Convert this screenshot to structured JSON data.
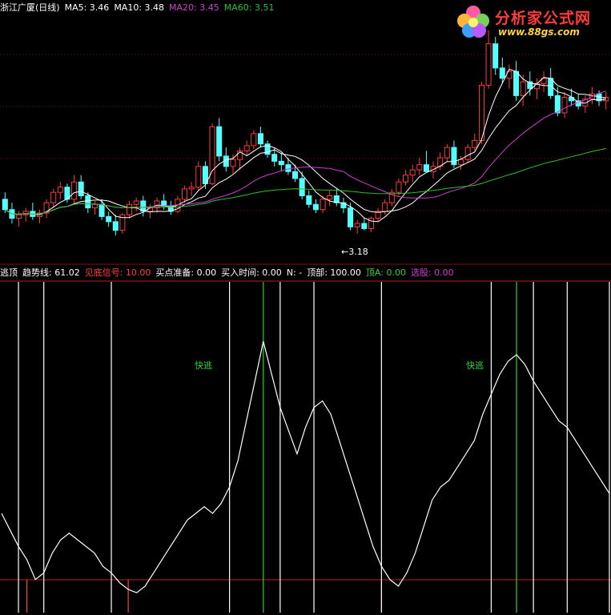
{
  "colors": {
    "background": "#000000",
    "up_candle": "#ff3b3b",
    "down_candle": "#54ffff",
    "ma5": "#ffffff",
    "ma10": "#ffffff",
    "ma20": "#d23bd2",
    "ma60": "#2fbf2f",
    "grid_dots": "#7a1010",
    "trend_line": "#ffffff",
    "bottom_signal": "#ff4040",
    "buy_signal": "#ffff80",
    "top_signal": "#ffffff",
    "fast_escape": "#33d033",
    "ref_line_top": "#ff3030",
    "ref_line_bottom": "#c02020"
  },
  "price_header": {
    "stock": "浙江广厦(日线)",
    "ma5": "MA5: 3.46",
    "ma10": "MA10: 3.48",
    "ma20": "MA20: 3.45",
    "ma60": "MA60: 3.51"
  },
  "indicator_header": {
    "name": "逃顶",
    "trend": "趋势线: 61.02",
    "bottom_signal": "见底信号: 10.00",
    "buy_prep": "买点准备: 0.00",
    "buy_time": "买入时间: 0.00",
    "n": "N: -",
    "top": "顶部: 100.00",
    "top_a": "顶A: 0.00",
    "select": "选股: 0.00"
  },
  "logo": {
    "title": "分析家公式网",
    "url": "www.88gs.com",
    "icon": "flower-logo-icon"
  },
  "annotations": {
    "low_price": "3.18",
    "fast_escape_1": "快逃",
    "fast_escape_2": "快逃"
  },
  "chart_data": [
    {
      "type": "candlestick",
      "title": "浙江广厦(日线)",
      "ylim": [
        3.05,
        4.45
      ],
      "annotations": [
        "3.18"
      ],
      "candles": [
        [
          3.38,
          3.42,
          3.3,
          3.32
        ],
        [
          3.32,
          3.36,
          3.24,
          3.27
        ],
        [
          3.27,
          3.31,
          3.22,
          3.29
        ],
        [
          3.29,
          3.33,
          3.25,
          3.31
        ],
        [
          3.31,
          3.36,
          3.26,
          3.28
        ],
        [
          3.28,
          3.32,
          3.24,
          3.3
        ],
        [
          3.3,
          3.38,
          3.27,
          3.36
        ],
        [
          3.36,
          3.44,
          3.33,
          3.42
        ],
        [
          3.42,
          3.48,
          3.38,
          3.45
        ],
        [
          3.45,
          3.47,
          3.36,
          3.38
        ],
        [
          3.38,
          3.52,
          3.35,
          3.48
        ],
        [
          3.48,
          3.52,
          3.38,
          3.4
        ],
        [
          3.4,
          3.42,
          3.3,
          3.33
        ],
        [
          3.33,
          3.37,
          3.29,
          3.35
        ],
        [
          3.35,
          3.38,
          3.26,
          3.28
        ],
        [
          3.28,
          3.31,
          3.22,
          3.25
        ],
        [
          3.25,
          3.29,
          3.17,
          3.2
        ],
        [
          3.2,
          3.3,
          3.18,
          3.29
        ],
        [
          3.29,
          3.37,
          3.27,
          3.35
        ],
        [
          3.35,
          3.39,
          3.31,
          3.37
        ],
        [
          3.37,
          3.4,
          3.28,
          3.31
        ],
        [
          3.31,
          3.35,
          3.27,
          3.33
        ],
        [
          3.33,
          3.39,
          3.3,
          3.37
        ],
        [
          3.37,
          3.41,
          3.32,
          3.34
        ],
        [
          3.34,
          3.37,
          3.29,
          3.31
        ],
        [
          3.31,
          3.4,
          3.3,
          3.38
        ],
        [
          3.38,
          3.46,
          3.36,
          3.44
        ],
        [
          3.44,
          3.48,
          3.4,
          3.45
        ],
        [
          3.45,
          3.6,
          3.43,
          3.57
        ],
        [
          3.57,
          3.6,
          3.44,
          3.47
        ],
        [
          3.47,
          3.82,
          3.46,
          3.8
        ],
        [
          3.8,
          3.85,
          3.6,
          3.63
        ],
        [
          3.63,
          3.68,
          3.54,
          3.57
        ],
        [
          3.57,
          3.64,
          3.53,
          3.61
        ],
        [
          3.61,
          3.68,
          3.55,
          3.66
        ],
        [
          3.66,
          3.72,
          3.63,
          3.69
        ],
        [
          3.69,
          3.78,
          3.67,
          3.76
        ],
        [
          3.76,
          3.8,
          3.68,
          3.7
        ],
        [
          3.7,
          3.72,
          3.62,
          3.64
        ],
        [
          3.64,
          3.68,
          3.57,
          3.6
        ],
        [
          3.6,
          3.65,
          3.54,
          3.58
        ],
        [
          3.58,
          3.62,
          3.52,
          3.54
        ],
        [
          3.54,
          3.58,
          3.48,
          3.5
        ],
        [
          3.5,
          3.54,
          3.38,
          3.4
        ],
        [
          3.4,
          3.43,
          3.33,
          3.35
        ],
        [
          3.35,
          3.38,
          3.3,
          3.32
        ],
        [
          3.32,
          3.4,
          3.3,
          3.38
        ],
        [
          3.38,
          3.43,
          3.34,
          3.4
        ],
        [
          3.4,
          3.44,
          3.34,
          3.36
        ],
        [
          3.36,
          3.39,
          3.3,
          3.33
        ],
        [
          3.33,
          3.36,
          3.2,
          3.22
        ],
        [
          3.22,
          3.26,
          3.18,
          3.24
        ],
        [
          3.24,
          3.27,
          3.2,
          3.21
        ],
        [
          3.21,
          3.28,
          3.19,
          3.27
        ],
        [
          3.27,
          3.33,
          3.25,
          3.31
        ],
        [
          3.31,
          3.38,
          3.29,
          3.36
        ],
        [
          3.36,
          3.44,
          3.34,
          3.42
        ],
        [
          3.42,
          3.5,
          3.4,
          3.48
        ],
        [
          3.48,
          3.55,
          3.46,
          3.52
        ],
        [
          3.52,
          3.58,
          3.48,
          3.55
        ],
        [
          3.55,
          3.62,
          3.52,
          3.58
        ],
        [
          3.58,
          3.66,
          3.54,
          3.54
        ],
        [
          3.54,
          3.6,
          3.5,
          3.57
        ],
        [
          3.57,
          3.65,
          3.55,
          3.62
        ],
        [
          3.62,
          3.7,
          3.6,
          3.68
        ],
        [
          3.68,
          3.72,
          3.56,
          3.58
        ],
        [
          3.58,
          3.63,
          3.55,
          3.61
        ],
        [
          3.61,
          3.7,
          3.59,
          3.68
        ],
        [
          3.68,
          3.76,
          3.66,
          3.72
        ],
        [
          3.72,
          4.06,
          3.7,
          4.04
        ],
        [
          4.04,
          4.36,
          4.02,
          4.28
        ],
        [
          4.28,
          4.32,
          4.1,
          4.14
        ],
        [
          4.14,
          4.2,
          4.05,
          4.08
        ],
        [
          4.08,
          4.16,
          4.02,
          4.12
        ],
        [
          4.12,
          4.18,
          3.95,
          3.98
        ],
        [
          3.98,
          4.1,
          3.92,
          4.06
        ],
        [
          4.06,
          4.12,
          3.98,
          4.02
        ],
        [
          4.02,
          4.08,
          3.96,
          4.05
        ],
        [
          4.05,
          4.12,
          4.0,
          4.08
        ],
        [
          4.08,
          4.14,
          3.96,
          3.98
        ],
        [
          3.98,
          4.03,
          3.86,
          3.88
        ],
        [
          3.88,
          4.0,
          3.85,
          3.97
        ],
        [
          3.97,
          4.02,
          3.92,
          3.95
        ],
        [
          3.95,
          3.99,
          3.9,
          3.92
        ],
        [
          3.92,
          3.98,
          3.88,
          3.96
        ],
        [
          3.96,
          4.03,
          3.93,
          3.99
        ],
        [
          3.99,
          4.01,
          3.92,
          3.95
        ],
        [
          3.95,
          4.0,
          3.9,
          3.97
        ]
      ]
    },
    {
      "type": "line",
      "title": "逃顶",
      "ylim": [
        0,
        100
      ],
      "series": [
        {
          "name": "趋势线",
          "values": [
            30,
            25,
            20,
            16,
            10,
            12,
            18,
            22,
            24,
            22,
            20,
            18,
            14,
            12,
            9,
            7,
            6,
            8,
            12,
            16,
            20,
            24,
            28,
            30,
            32,
            30,
            33,
            38,
            46,
            58,
            70,
            82,
            72,
            62,
            55,
            48,
            56,
            62,
            64,
            60,
            52,
            44,
            36,
            28,
            20,
            14,
            10,
            8,
            12,
            18,
            26,
            34,
            38,
            40,
            44,
            48,
            52,
            60,
            66,
            72,
            76,
            78,
            75,
            70,
            66,
            62,
            58,
            56,
            52,
            48,
            44,
            40,
            36
          ]
        },
        {
          "name": "见底信号",
          "values": [
            0,
            0,
            0,
            10,
            0,
            0,
            0,
            0,
            0,
            0,
            0,
            0,
            0,
            0,
            0,
            10,
            0,
            0,
            0,
            0,
            0,
            0,
            0,
            0,
            0,
            0,
            0,
            0,
            0,
            0,
            0,
            0,
            0,
            0,
            0,
            0,
            0,
            0,
            0,
            0,
            0,
            0,
            0,
            0,
            0,
            10,
            0,
            0,
            0,
            0,
            0,
            0,
            0,
            0,
            0,
            0,
            0,
            0,
            0,
            0,
            0,
            0,
            0,
            0,
            0,
            0,
            0,
            0,
            0,
            0,
            0,
            0,
            10
          ]
        },
        {
          "name": "顶部",
          "values": [
            0,
            0,
            100,
            0,
            0,
            100,
            0,
            0,
            0,
            0,
            0,
            0,
            0,
            100,
            0,
            0,
            0,
            0,
            0,
            0,
            0,
            0,
            0,
            0,
            0,
            0,
            0,
            100,
            0,
            0,
            0,
            0,
            0,
            100,
            0,
            0,
            0,
            100,
            0,
            0,
            0,
            0,
            0,
            0,
            0,
            100,
            0,
            0,
            0,
            0,
            0,
            0,
            0,
            0,
            0,
            0,
            0,
            0,
            100,
            0,
            0,
            0,
            0,
            100,
            0,
            0,
            0,
            100,
            0,
            0,
            0,
            0,
            100
          ]
        },
        {
          "name": "顶A",
          "values": [
            0,
            0,
            0,
            0,
            0,
            0,
            0,
            0,
            0,
            0,
            0,
            0,
            0,
            0,
            0,
            0,
            0,
            0,
            0,
            0,
            0,
            0,
            0,
            0,
            0,
            0,
            0,
            0,
            0,
            0,
            0,
            100,
            0,
            0,
            0,
            0,
            0,
            0,
            0,
            0,
            0,
            0,
            0,
            0,
            0,
            0,
            0,
            0,
            0,
            0,
            0,
            0,
            0,
            0,
            0,
            0,
            0,
            0,
            0,
            0,
            0,
            100,
            0,
            0,
            0,
            0,
            0,
            0,
            0,
            0,
            0,
            0,
            0
          ]
        }
      ],
      "annotations": [
        "快逃",
        "快逃"
      ]
    }
  ]
}
